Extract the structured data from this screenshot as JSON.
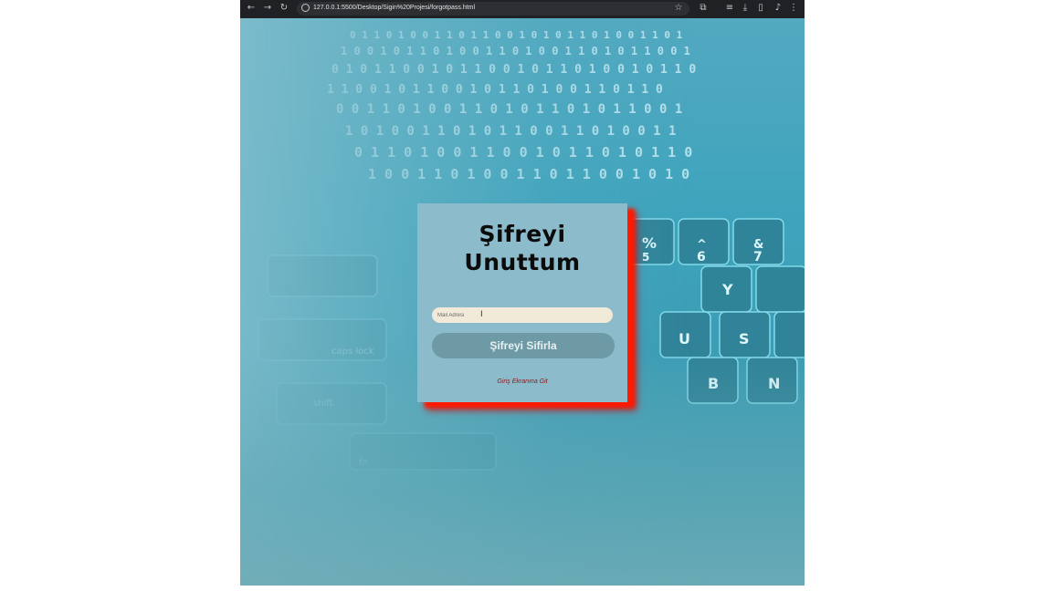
{
  "browser": {
    "url": "127.0.0.1:5500/Desktop/Sigin%20Projesi/forgotpass.html",
    "icons": {
      "back": "back-arrow-icon",
      "forward": "forward-arrow-icon",
      "reload": "reload-icon",
      "site_info": "site-info-icon",
      "bookmark": "star-icon",
      "extensions": "puzzle-icon",
      "media": "media-icon",
      "download": "download-icon",
      "sidepanel": "side-panel-icon",
      "profile": "profile-icon",
      "menu": "kebab-menu-icon"
    }
  },
  "page": {
    "title": "Şifreyi Unuttum",
    "email_placeholder": "Mail Adresi",
    "reset_label": "Şifreyi Sifirla",
    "login_link": "Giriş Ekranına Git",
    "colors": {
      "card_bg": "#8cbccb",
      "card_shadow": "#ff1a00",
      "input_bg": "#f2ead8",
      "button_bg": "#6e9aa6",
      "link": "#8b1a1a"
    }
  }
}
